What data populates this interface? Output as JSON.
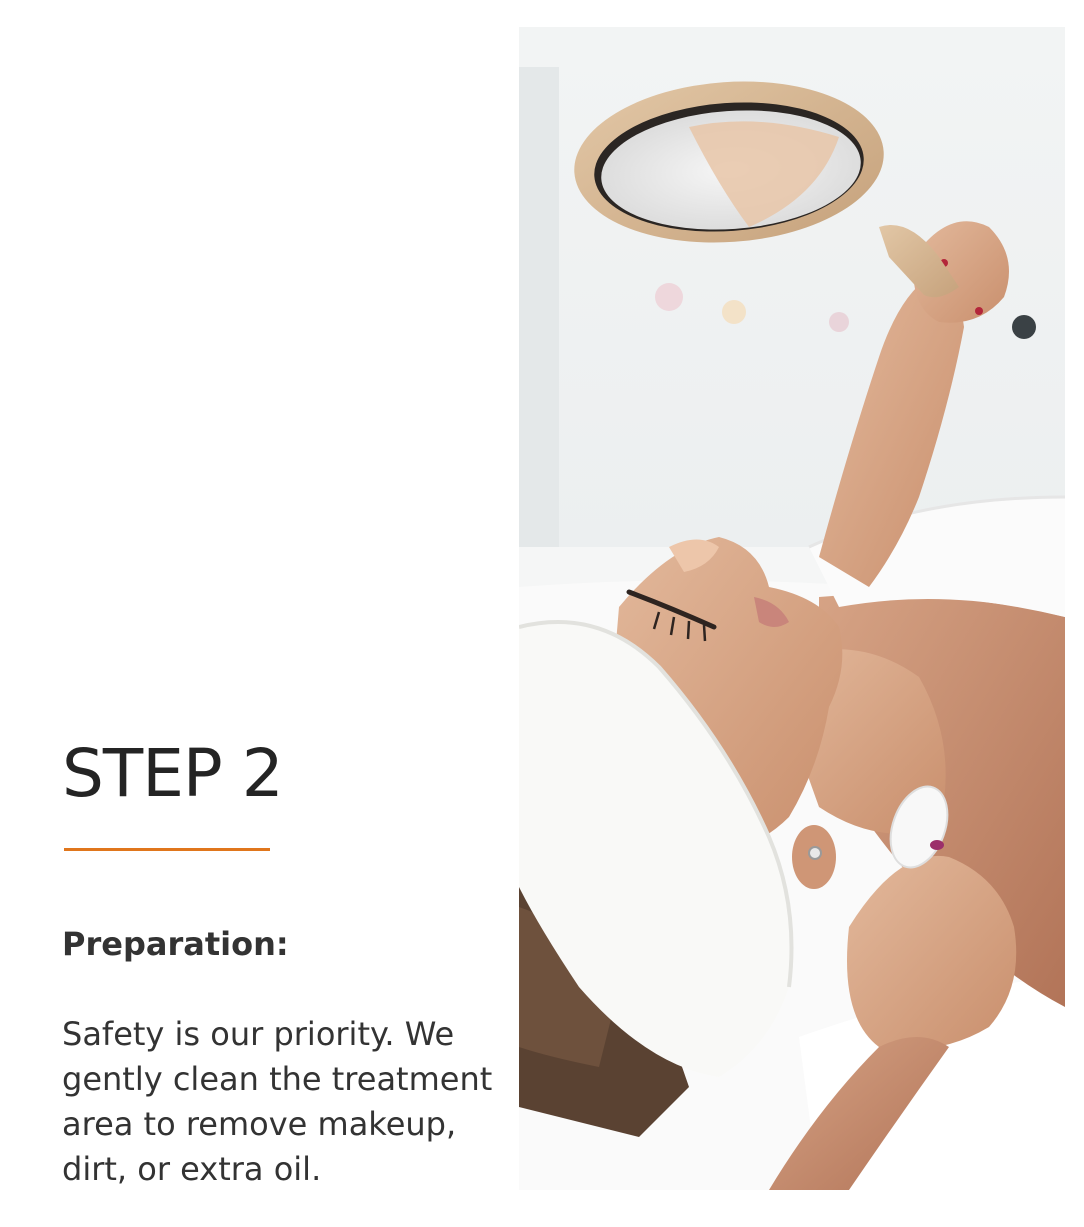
{
  "step": {
    "title": "STEP 2",
    "accent_color": "#e0761c"
  },
  "content": {
    "subheading": "Preparation:",
    "body": "Safety is our priority. We gently clean the treatment area to remove makeup, dirt, or extra oil."
  }
}
